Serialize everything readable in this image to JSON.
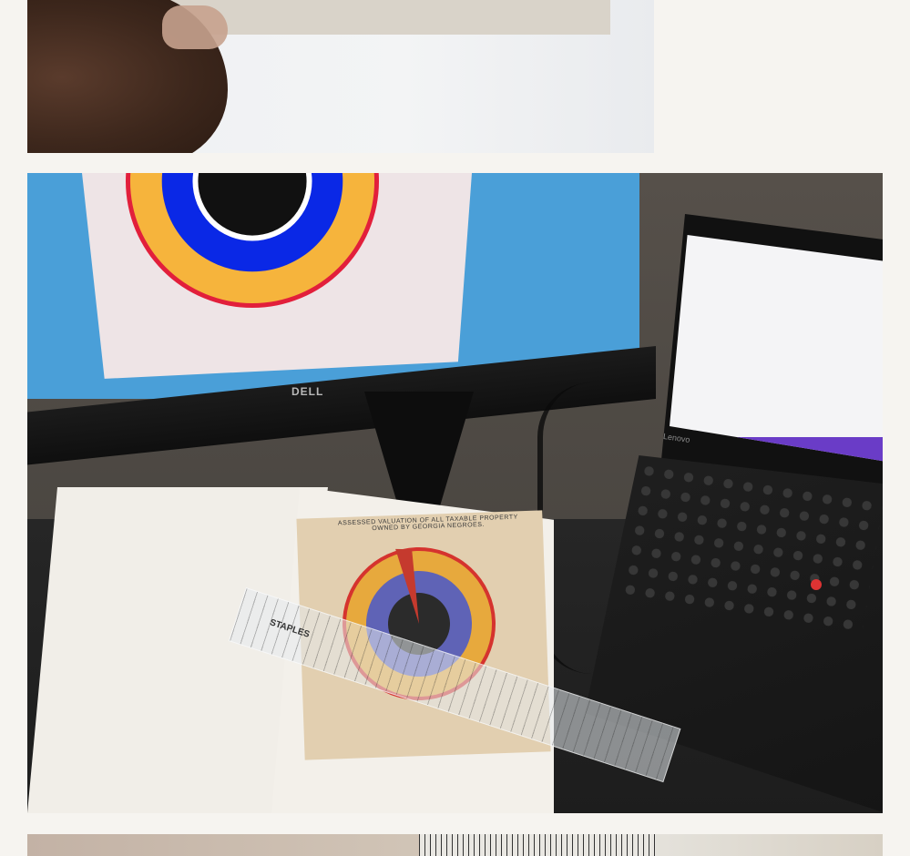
{
  "photos": {
    "top": {},
    "main": {
      "monitor_logo": "DELL",
      "laptop_brand": "Lenovo",
      "ruler_brand": "STAPLES",
      "plate_title": "ASSESSED VALUATION OF ALL TAXABLE PROPERTY OWNED BY GEORGIA NEGROES."
    },
    "bottom": {}
  },
  "colors": {
    "chart_black": "#111111",
    "chart_blue": "#0a28e6",
    "chart_yellow": "#f6b43c",
    "chart_red": "#e21f3b"
  }
}
